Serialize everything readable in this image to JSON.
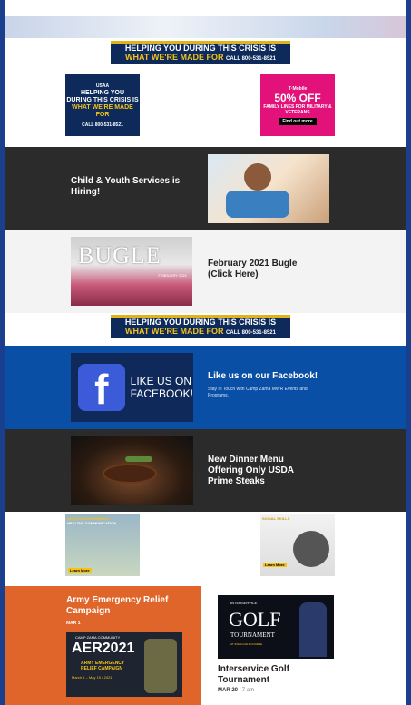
{
  "usaa_banner": {
    "line1": "HELPING YOU DURING THIS CRISIS IS",
    "line2": "WHAT WE'RE MADE FOR",
    "call": "CALL 800-531-8521",
    "brand": "USAA"
  },
  "usaa_box": {
    "brand": "USAA",
    "line1": "HELPING YOU",
    "line2": "DURING THIS CRISIS IS",
    "line3": "WHAT WE'RE MADE FOR",
    "call": "CALL 800-531-8521"
  },
  "tmobile": {
    "brand": "T·Mobile",
    "offer": "50% OFF",
    "sub": "FAMILY LINES FOR MILITARY & VETERANS",
    "cta": "Find out more"
  },
  "child_youth": {
    "title": "Child & Youth Services is Hiring!"
  },
  "bugle": {
    "masthead": "BUGLE",
    "date": "FEBRUARY 2021",
    "title": "February 2021 Bugle (Click Here)"
  },
  "facebook": {
    "logo_letter": "f",
    "logo_text_1": "LIKE US ON",
    "logo_text_2": "FACEBOOK!",
    "title": "Like us on our Facebook!",
    "desc": "Stay In Touch with Camp Zama MWR Events and Programs."
  },
  "dinner": {
    "title": "New Dinner Menu Offering Only USDA Prime Steaks"
  },
  "relationship": {
    "ad1_line1": "RELATIONSHIP INSIGHT",
    "ad1_line2": "HEALTHY COMMUNICATION",
    "ad1_cta": "Learn More",
    "ad2_line1": "SOCIAL SKILLS",
    "ad2_cta": "Learn More"
  },
  "aer": {
    "title": "Army Emergency Relief Campaign",
    "date": "MAR 1",
    "poster_top": "CAMP ZAMA COMMUNITY",
    "poster_year": "AER2021",
    "poster_l1": "ARMY EMERGENCY",
    "poster_l2": "RELIEF CAMPAIGN",
    "poster_dates": "March 1 – May 15 • 2021"
  },
  "golf": {
    "poster_top": "INTERSERVICE",
    "poster_big": "GOLF",
    "poster_sub": "TOURNAMENT",
    "poster_loc": "AT ZAMA GOLF COURSE",
    "title": "Interservice Golf Tournament",
    "date": "MAR 20",
    "time": "7 am"
  },
  "colors": {
    "navy": "#0d2a5a",
    "gold": "#f4c21c",
    "magenta": "#e2127a",
    "dark": "#2b2b2b",
    "blue": "#0a4fa6",
    "orange": "#e0652a"
  }
}
